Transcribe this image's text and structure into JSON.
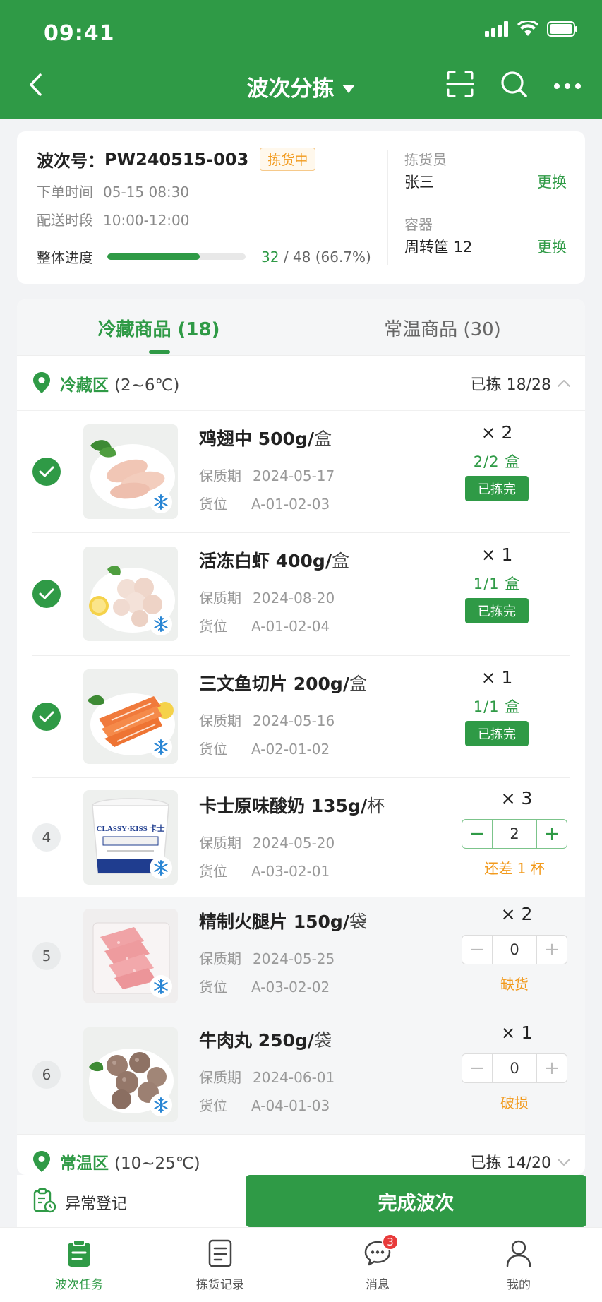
{
  "status_bar": {
    "time": "09:41"
  },
  "nav": {
    "title": "波次分拣"
  },
  "wave": {
    "label": "波次号：",
    "number": "PW240515-003",
    "status": "拣货中",
    "order_time_label": "下单时间",
    "order_time": "05-15 08:30",
    "delivery_label": "配送时段",
    "delivery_window": "10:00-12:00",
    "progress_label": "整体进度",
    "progress_done": "32",
    "progress_total": "/ 48 (66.7%)",
    "progress_fraction": 0.667,
    "picker_label": "拣货员",
    "picker_name": "张三",
    "picker_action": "更换",
    "container_label": "容器",
    "container_value": "周转筐 12",
    "container_action": "更换"
  },
  "tabs": [
    {
      "label": "冷藏商品 (18)"
    },
    {
      "label": "常温商品 (30)"
    }
  ],
  "zones": {
    "cold": {
      "name": "冷藏区",
      "temp": "(2~6℃)",
      "count": "已拣 18/28"
    },
    "ambient": {
      "name": "常温区",
      "temp": "(10~25℃)",
      "count": "已拣 14/20"
    }
  },
  "item_labels": {
    "shelf_life": "保质期",
    "location": "货位"
  },
  "items": [
    {
      "name": "鸡翅中",
      "spec": "500g/",
      "unit": "盒",
      "expiry": "2024-05-17",
      "location": "A-01-02-03",
      "qty": "× 2",
      "picked": "2/2 盒",
      "badge": "已拣完"
    },
    {
      "name": "活冻白虾",
      "spec": "400g/",
      "unit": "盒",
      "expiry": "2024-08-20",
      "location": "A-01-02-04",
      "qty": "× 1",
      "picked": "1/1 盒",
      "badge": "已拣完"
    },
    {
      "name": "三文鱼切片",
      "spec": "200g/",
      "unit": "盒",
      "expiry": "2024-05-16",
      "location": "A-02-01-02",
      "qty": "× 1",
      "picked": "1/1 盒",
      "badge": "已拣完"
    },
    {
      "index": "4",
      "name": "卡士原味酸奶",
      "spec": "135g/",
      "unit": "杯",
      "expiry": "2024-05-20",
      "location": "A-03-02-01",
      "qty": "× 3",
      "value": "2",
      "status": "还差 1 杯"
    },
    {
      "index": "5",
      "name": "精制火腿片",
      "spec": "150g/",
      "unit": "袋",
      "expiry": "2024-05-25",
      "location": "A-03-02-02",
      "qty": "× 2",
      "value": "0",
      "status": "缺货"
    },
    {
      "index": "6",
      "name": "牛肉丸",
      "spec": "250g/",
      "unit": "袋",
      "expiry": "2024-06-01",
      "location": "A-04-01-03",
      "qty": "× 1",
      "value": "0",
      "status": "破损"
    }
  ],
  "stepper": {
    "minus": "−",
    "plus": "+"
  },
  "yogurt_brand": "CLASSY·KISS 卡士",
  "bottom": {
    "exception": "异常登记",
    "complete": "完成波次"
  },
  "tabbar": [
    {
      "label": "波次任务",
      "icon": "clipboard-icon"
    },
    {
      "label": "拣货记录",
      "icon": "document-icon"
    },
    {
      "label": "消息",
      "icon": "message-icon",
      "badge": "3"
    },
    {
      "label": "我的",
      "icon": "user-icon"
    }
  ],
  "colors": {
    "brand": "#2f9a46",
    "warning": "#f29a1d",
    "badge": "#e83a3a"
  }
}
